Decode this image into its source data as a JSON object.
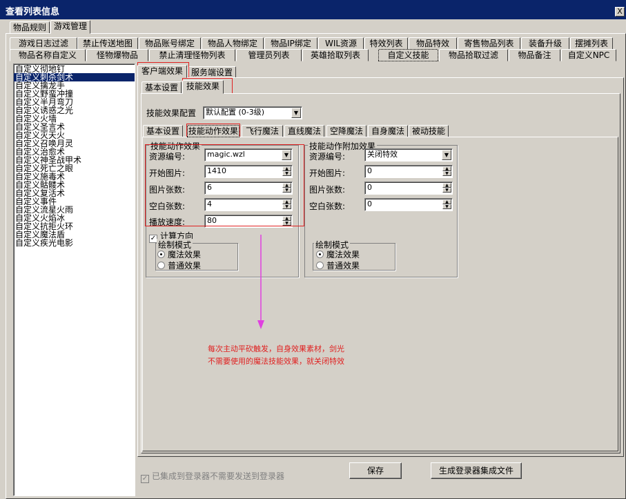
{
  "window": {
    "title": "查看列表信息",
    "close_glyph": "X"
  },
  "top_tabs": [
    {
      "label": "物品规则"
    },
    {
      "label": "游戏管理"
    }
  ],
  "row1_tabs": [
    {
      "label": "游戏日志过滤"
    },
    {
      "label": "禁止传送地图"
    },
    {
      "label": "物品账号绑定"
    },
    {
      "label": "物品人物绑定"
    },
    {
      "label": "物品IP绑定"
    },
    {
      "label": "WIL资源"
    },
    {
      "label": "特效列表"
    },
    {
      "label": "物品特效"
    },
    {
      "label": "寄售物品列表"
    },
    {
      "label": "装备升级"
    },
    {
      "label": "摆摊列表"
    }
  ],
  "row2_tabs": [
    {
      "label": "物品名称自定义"
    },
    {
      "label": "怪物爆物品"
    },
    {
      "label": "禁止清理怪物列表"
    },
    {
      "label": "管理员列表"
    },
    {
      "label": "英雄拾取列表"
    },
    {
      "label": "自定义技能"
    },
    {
      "label": "物品拾取过滤"
    },
    {
      "label": "物品备注"
    },
    {
      "label": "自定义NPC"
    }
  ],
  "skill_list": {
    "items": [
      "自定义彻地钉",
      "自定义刺杀剑术",
      "自定义擒龙手",
      "自定义野蛮冲撞",
      "自定义半月弯刀",
      "自定义诱惑之光",
      "自定义火墙",
      "自定义圣言术",
      "自定义灭天火",
      "自定义召唤月灵",
      "自定义治愈术",
      "自定义神圣战甲术",
      "自定义死亡之眼",
      "自定义施毒术",
      "自定义骷髅术",
      "自定义复活术",
      "自定义事件",
      "自定义流星火雨",
      "自定义火焰冰",
      "自定义抗拒火环",
      "自定义魔法盾",
      "自定义疾光电影"
    ],
    "selected_index": 1
  },
  "side_tabs": [
    {
      "label": "客户端效果"
    },
    {
      "label": "服务端设置"
    }
  ],
  "sub_tabs": [
    {
      "label": "基本设置"
    },
    {
      "label": "技能效果"
    }
  ],
  "effect_config": {
    "label": "技能效果配置",
    "value": "默认配置 (0-3级)"
  },
  "inner_tabs": [
    {
      "label": "基本设置"
    },
    {
      "label": "技能动作效果"
    },
    {
      "label": "飞行魔法"
    },
    {
      "label": "直线魔法"
    },
    {
      "label": "空降魔法"
    },
    {
      "label": "自身魔法"
    },
    {
      "label": "被动技能"
    }
  ],
  "action_effect": {
    "title": "技能动作效果",
    "resource_label": "资源编号:",
    "resource_value": "magic.wzl",
    "start_label": "开始图片:",
    "start_value": "1410",
    "count_label": "图片张数:",
    "count_value": "6",
    "blank_label": "空白张数:",
    "blank_value": "4",
    "speed_label": "播放速度:",
    "speed_value": "80",
    "calc_dir_label": "计算方向",
    "calc_dir_glyph": "✓",
    "draw_mode": {
      "title": "绘制模式",
      "option1": "魔法效果",
      "option2": "普通效果"
    }
  },
  "extra_effect": {
    "title": "技能动作附加效果",
    "resource_label": "资源编号:",
    "resource_value": "关闭特效",
    "start_label": "开始图片:",
    "start_value": "0",
    "count_label": "图片张数:",
    "count_value": "0",
    "blank_label": "空白张数:",
    "blank_value": "0",
    "draw_mode": {
      "title": "绘制模式",
      "option1": "魔法效果",
      "option2": "普通效果"
    }
  },
  "annotation": {
    "line1": "每次主动平砍触发，自身效果素材，剑光",
    "line2": "不需要使用的魔法技能效果，就关闭特效",
    "color": "#e040e0",
    "text_color": "#e02020"
  },
  "footer": {
    "integrated_label": "已集成到登录器不需要发送到登录器",
    "check_glyph": "✓",
    "save_label": "保存",
    "generate_label": "生成登录器集成文件"
  }
}
